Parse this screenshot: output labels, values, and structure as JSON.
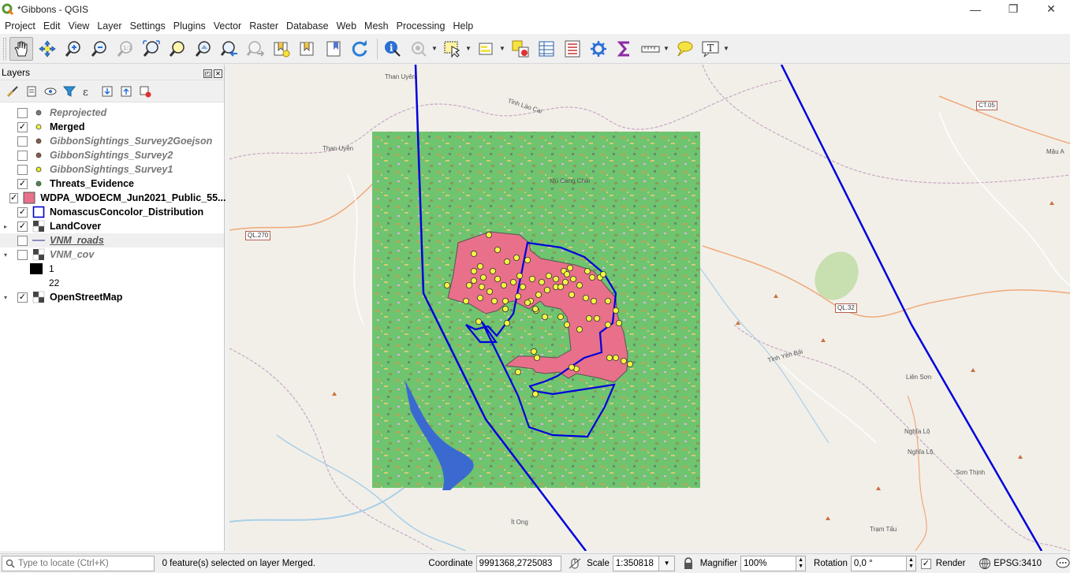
{
  "window": {
    "title": "*Gibbons - QGIS",
    "controls": [
      "—",
      "❐",
      "✕"
    ]
  },
  "menu": [
    "Project",
    "Edit",
    "View",
    "Layer",
    "Settings",
    "Plugins",
    "Vector",
    "Raster",
    "Database",
    "Web",
    "Mesh",
    "Processing",
    "Help"
  ],
  "toolbar": {
    "icons": [
      "pan-icon",
      "pan-to-selection-icon",
      "zoom-in-icon",
      "zoom-out-icon",
      "zoom-native-icon",
      "zoom-full-icon",
      "zoom-to-selection-icon",
      "zoom-to-layer-icon",
      "zoom-last-icon",
      "zoom-next-icon",
      "new-bookmark-icon",
      "show-bookmarks-icon",
      "new-map-view-icon",
      "refresh-icon",
      "identify-icon",
      "action-icon",
      "select-icon",
      "deselect-icon",
      "attribute-table-icon",
      "field-calculator-icon",
      "processing-toolbox-icon",
      "statistics-icon",
      "measure-icon",
      "annotation-icon",
      "text-annotation-icon"
    ]
  },
  "layers_panel": {
    "title": "Layers",
    "layers": [
      {
        "name": "Reprojected",
        "checked": false,
        "symbol": "point",
        "color": "#7a7a7a",
        "style": "off"
      },
      {
        "name": "Merged",
        "checked": true,
        "symbol": "point",
        "color": "#f5f542",
        "style": "on"
      },
      {
        "name": "GibbonSightings_Survey2Goejson",
        "checked": false,
        "symbol": "point",
        "color": "#8b5a4a",
        "style": "off"
      },
      {
        "name": "GibbonSightings_Survey2",
        "checked": false,
        "symbol": "point",
        "color": "#8b5a4a",
        "style": "off"
      },
      {
        "name": "GibbonSightings_Survey1",
        "checked": false,
        "symbol": "point",
        "color": "#e8e820",
        "style": "off"
      },
      {
        "name": "Threats_Evidence",
        "checked": true,
        "symbol": "point",
        "color": "#4a8a4a",
        "style": "on"
      },
      {
        "name": "WDPA_WDOECM_Jun2021_Public_55...",
        "checked": true,
        "symbol": "fill",
        "color": "#e8708a",
        "style": "on"
      },
      {
        "name": "NomascusConcolor_Distribution",
        "checked": true,
        "symbol": "outline",
        "color": "#0000cc",
        "style": "on"
      },
      {
        "name": "LandCover",
        "checked": true,
        "symbol": "raster",
        "color": "#444444",
        "style": "on",
        "expander": "▸"
      },
      {
        "name": "VNM_roads",
        "checked": false,
        "symbol": "line",
        "color": "#6a6aaa",
        "style": "underline"
      },
      {
        "name": "VNM_cov",
        "checked": false,
        "symbol": "raster",
        "color": "#444444",
        "style": "off",
        "expander": "▾"
      }
    ],
    "legend": [
      {
        "label": "1",
        "color": "#000000"
      },
      {
        "label": "22",
        "color": "#ffffff"
      }
    ],
    "last_layer": {
      "name": "OpenStreetMap",
      "checked": true,
      "expander": "▾"
    }
  },
  "map": {
    "labels": [
      {
        "text": "Than Uyên"
      },
      {
        "text": "Tỉnh Lào Cai"
      },
      {
        "text": "Than Uyên"
      },
      {
        "text": "Mù Cang Chải"
      },
      {
        "text": "Liên Sơn"
      },
      {
        "text": "Nghĩa Lộ"
      },
      {
        "text": "Nghĩa Lộ"
      },
      {
        "text": "Sơn Thịnh"
      },
      {
        "text": "Ít Ong"
      },
      {
        "text": "Trạm Tấu"
      },
      {
        "text": "Tỉnh Yên Bái"
      },
      {
        "text": "Mậu A"
      }
    ],
    "shields": [
      "CT.05",
      "QL.270",
      "QL.32"
    ]
  },
  "status": {
    "locator_placeholder": "Type to locate (Ctrl+K)",
    "message": "0 feature(s) selected on layer Merged.",
    "coordinate_label": "Coordinate",
    "coordinate_value": "9991368,2725083",
    "scale_label": "Scale",
    "scale_value": "1:350818",
    "magnifier_label": "Magnifier",
    "magnifier_value": "100%",
    "rotation_label": "Rotation",
    "rotation_value": "0,0 °",
    "render_label": "Render",
    "crs": "EPSG:3410"
  }
}
